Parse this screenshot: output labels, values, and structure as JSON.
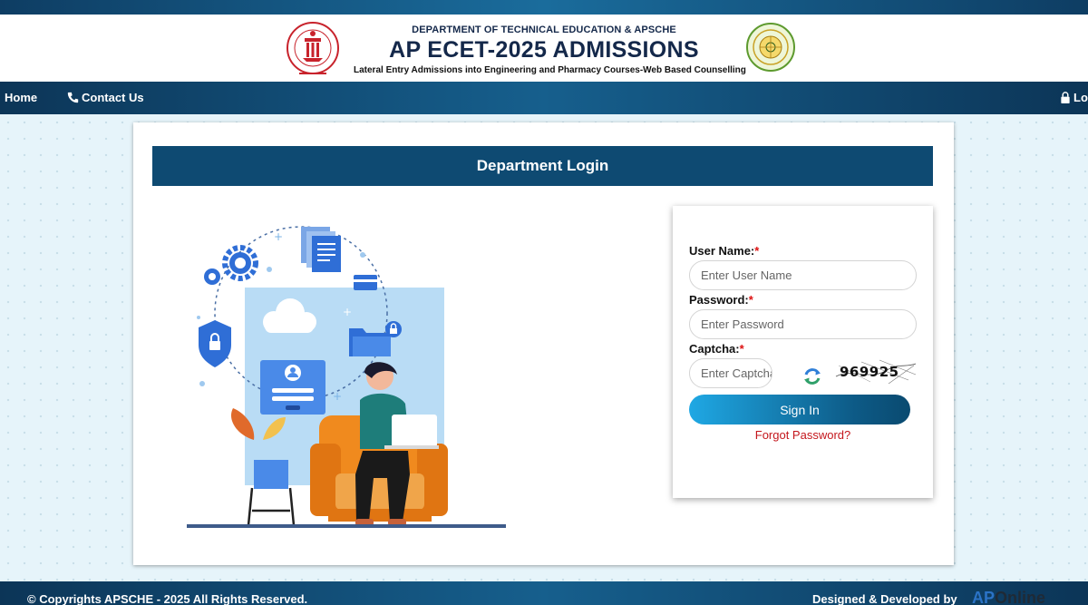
{
  "header": {
    "department": "DEPARTMENT OF TECHNICAL EDUCATION & APSCHE",
    "title": "AP ECET-2025 ADMISSIONS",
    "subtitle": "Lateral Entry Admissions into Engineering and Pharmacy Courses-Web Based Counselling"
  },
  "nav": {
    "home": "Home",
    "contact": "Contact Us",
    "login": "Login"
  },
  "login": {
    "title": "Department Login",
    "username_label": "User Name:",
    "username_placeholder": "Enter User Name",
    "password_label": "Password:",
    "password_placeholder": "Enter Password",
    "captcha_label": "Captcha:",
    "captcha_placeholder": "Enter Captcha",
    "captcha_code": "969925",
    "required_mark": "*",
    "signin": "Sign In",
    "forgot": "Forgot Password?"
  },
  "footer": {
    "copyright": "© Copyrights APSCHE - 2025 All Rights Reserved.",
    "designed": "Designed & Developed by",
    "brand_part1": "AP",
    "brand_part2": "Online"
  },
  "colors": {
    "navy": "#0e4a72",
    "button_start": "#1fa8e4",
    "required": "#d11111",
    "forgot_link": "#c4161c"
  },
  "icons": [
    "phone-icon",
    "lock-icon",
    "refresh-icon",
    "gear-icon",
    "shield-lock-icon",
    "document-icon",
    "folder-lock-icon",
    "cloud-icon",
    "user-icon"
  ]
}
